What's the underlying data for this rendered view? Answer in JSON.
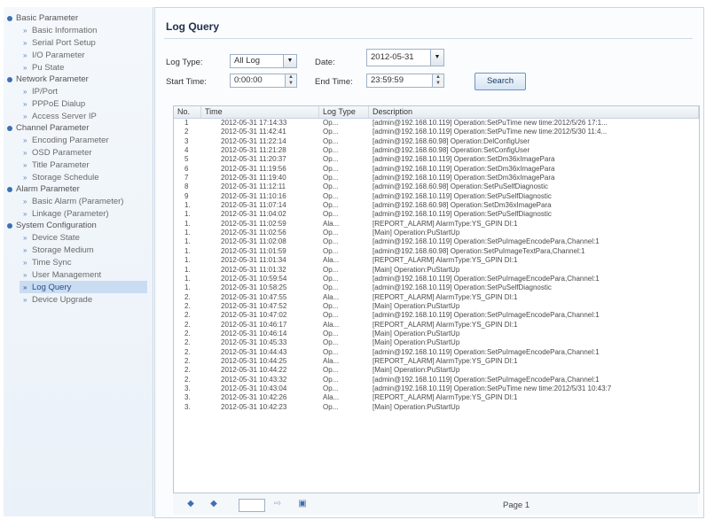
{
  "sidebar": {
    "groups": [
      {
        "label": "Basic Parameter",
        "items": [
          "Basic Information",
          "Serial Port Setup",
          "I/O Parameter",
          "Pu State"
        ]
      },
      {
        "label": "Network Parameter",
        "items": [
          "IP/Port",
          "PPPoE Dialup",
          "Access Server IP"
        ]
      },
      {
        "label": "Channel Parameter",
        "items": [
          "Encoding Parameter",
          "OSD Parameter",
          "Title Parameter",
          "Storage Schedule"
        ]
      },
      {
        "label": "Alarm Parameter",
        "items": [
          "Basic Alarm (Parameter)",
          "Linkage (Parameter)"
        ]
      },
      {
        "label": "System Configuration",
        "items": [
          "Device State",
          "Storage Medium",
          "Time Sync",
          "User Management",
          "Log Query",
          "Device Upgrade"
        ]
      }
    ],
    "active": "Log Query"
  },
  "main": {
    "title": "Log Query",
    "log_type_label": "Log Type:",
    "log_type_value": "All Log",
    "date_label": "Date:",
    "date_value": "2012-05-31",
    "start_time_label": "Start Time:",
    "start_time_value": "0:00:00",
    "end_time_label": "End Time:",
    "end_time_value": "23:59:59",
    "search_label": "Search"
  },
  "table": {
    "headers": [
      "No.",
      "Time",
      "Log Type",
      "Description"
    ],
    "rows": [
      [
        "1",
        "2012-05-31 17:14:33",
        "Op...",
        "[admin@192.168.10.119] Operation:SetPuTime new time:2012/5/26 17:1..."
      ],
      [
        "2",
        "2012-05-31 11:42:41",
        "Op...",
        "[admin@192.168.10.119] Operation:SetPuTime new time:2012/5/30 11:4..."
      ],
      [
        "3",
        "2012-05-31 11:22:14",
        "Op...",
        "[admin@192.168.60.98] Operation:DelConfigUser"
      ],
      [
        "4",
        "2012-05-31 11:21:28",
        "Op...",
        "[admin@192.168.60.98] Operation:SetConfigUser"
      ],
      [
        "5",
        "2012-05-31 11:20:37",
        "Op...",
        "[admin@192.168.10.119] Operation:SetDm36xImagePara"
      ],
      [
        "6",
        "2012-05-31 11:19:56",
        "Op...",
        "[admin@192.168.10.119] Operation:SetDm36xImagePara"
      ],
      [
        "7",
        "2012-05-31 11:19:40",
        "Op...",
        "[admin@192.168.10.119] Operation:SetDm36xImagePara"
      ],
      [
        "8",
        "2012-05-31 11:12:11",
        "Op...",
        "[admin@192.168.60.98] Operation:SetPuSelfDiagnostic"
      ],
      [
        "9",
        "2012-05-31 11:10:16",
        "Op...",
        "[admin@192.168.10.119] Operation:SetPuSelfDiagnostic"
      ],
      [
        "1.",
        "2012-05-31 11:07:14",
        "Op...",
        "[admin@192.168.60.98] Operation:SetDm36xImagePara"
      ],
      [
        "1.",
        "2012-05-31 11:04:02",
        "Op...",
        "[admin@192.168.10.119] Operation:SetPuSelfDiagnostic"
      ],
      [
        "1.",
        "2012-05-31 11:02:59",
        "Ala...",
        "[REPORT_ALARM] AlarmType:YS_GPIN DI:1"
      ],
      [
        "1.",
        "2012-05-31 11:02:56",
        "Op...",
        "[Main] Operation:PuStartUp"
      ],
      [
        "1.",
        "2012-05-31 11:02:08",
        "Op...",
        "[admin@192.168.10.119] Operation:SetPuImageEncodePara,Channel:1"
      ],
      [
        "1.",
        "2012-05-31 11:01:59",
        "Op...",
        "[admin@192.168.60.98] Operation:SetPuImageTextPara,Channel:1"
      ],
      [
        "1.",
        "2012-05-31 11:01:34",
        "Ala...",
        "[REPORT_ALARM] AlarmType:YS_GPIN DI:1"
      ],
      [
        "1.",
        "2012-05-31 11:01:32",
        "Op...",
        "[Main] Operation:PuStartUp"
      ],
      [
        "1.",
        "2012-05-31 10:59:54",
        "Op...",
        "[admin@192.168.10.119] Operation:SetPuImageEncodePara,Channel:1"
      ],
      [
        "1.",
        "2012-05-31 10:58:25",
        "Op...",
        "[admin@192.168.10.119] Operation:SetPuSelfDiagnostic"
      ],
      [
        "2.",
        "2012-05-31 10:47:55",
        "Ala...",
        "[REPORT_ALARM] AlarmType:YS_GPIN DI:1"
      ],
      [
        "2.",
        "2012-05-31 10:47:52",
        "Op...",
        "[Main] Operation:PuStartUp"
      ],
      [
        "2.",
        "2012-05-31 10:47:02",
        "Op...",
        "[admin@192.168.10.119] Operation:SetPuImageEncodePara,Channel:1"
      ],
      [
        "2.",
        "2012-05-31 10:46:17",
        "Ala...",
        "[REPORT_ALARM] AlarmType:YS_GPIN DI:1"
      ],
      [
        "2.",
        "2012-05-31 10:46:14",
        "Op...",
        "[Main] Operation:PuStartUp"
      ],
      [
        "2.",
        "2012-05-31 10:45:33",
        "Op...",
        "[Main] Operation:PuStartUp"
      ],
      [
        "2.",
        "2012-05-31 10:44:43",
        "Op...",
        "[admin@192.168.10.119] Operation:SetPuImageEncodePara,Channel:1"
      ],
      [
        "2.",
        "2012-05-31 10:44:25",
        "Ala...",
        "[REPORT_ALARM] AlarmType:YS_GPIN DI:1"
      ],
      [
        "2.",
        "2012-05-31 10:44:22",
        "Op...",
        "[Main] Operation:PuStartUp"
      ],
      [
        "2.",
        "2012-05-31 10:43:32",
        "Op...",
        "[admin@192.168.10.119] Operation:SetPuImageEncodePara,Channel:1"
      ],
      [
        "3.",
        "2012-05-31 10:43:04",
        "Op...",
        "[admin@192.168.10.119] Operation:SetPuTime new time:2012/5/31 10:43:7"
      ],
      [
        "3.",
        "2012-05-31 10:42:26",
        "Ala...",
        "[REPORT_ALARM] AlarmType:YS_GPIN DI:1"
      ],
      [
        "3.",
        "2012-05-31 10:42:23",
        "Op...",
        "[Main] Operation:PuStartUp"
      ]
    ]
  },
  "footer": {
    "page_label": "Page 1"
  }
}
